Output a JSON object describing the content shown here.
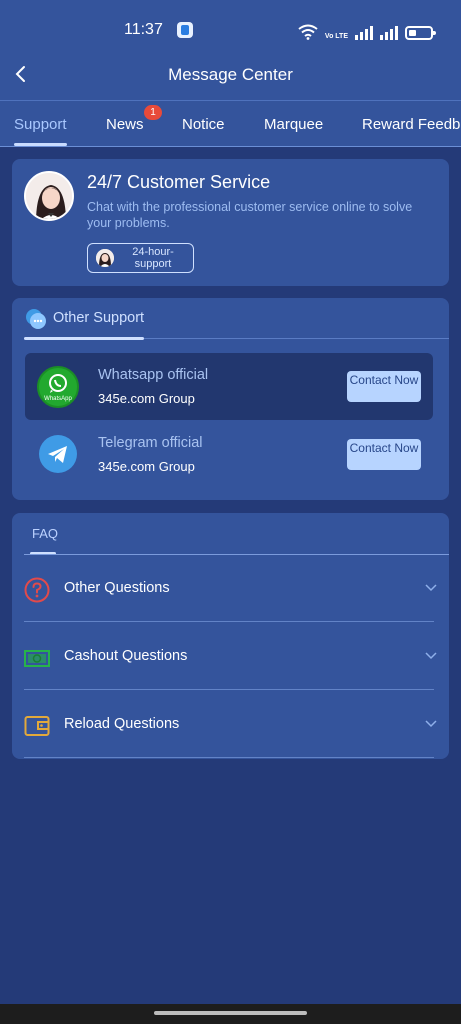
{
  "status_bar": {
    "time": "11:37",
    "network_label": "Vo LTE",
    "icons": [
      "app-notification-icon",
      "wifi-icon",
      "signal-icon",
      "battery-icon"
    ]
  },
  "header": {
    "title": "Message Center",
    "back_icon": "chevron-left-icon"
  },
  "tabs": [
    {
      "label": "Support",
      "active": true
    },
    {
      "label": "News",
      "badge": "1"
    },
    {
      "label": "Notice"
    },
    {
      "label": "Marquee"
    },
    {
      "label": "Reward Feedb"
    }
  ],
  "customer_service": {
    "title": "24/7 Customer Service",
    "description": "Chat with the professional customer service online to solve your problems.",
    "chip_label": "24-hour-support"
  },
  "other_support": {
    "title": "Other Support",
    "items": [
      {
        "name": "Whatsapp official",
        "group": "345e.com Group",
        "button": "Contact Now",
        "icon": "whatsapp-icon",
        "icon_text": "WhatsApp"
      },
      {
        "name": "Telegram official",
        "group": "345e.com Group",
        "button": "Contact Now",
        "icon": "telegram-icon"
      }
    ]
  },
  "faq": {
    "tab_label": "FAQ",
    "items": [
      {
        "label": "Other Questions",
        "icon": "question-icon",
        "color": "#e24a4a"
      },
      {
        "label": "Cashout Questions",
        "icon": "cash-icon",
        "color": "#27b34a"
      },
      {
        "label": "Reload Questions",
        "icon": "wallet-icon",
        "color": "#e2a93b"
      }
    ]
  },
  "colors": {
    "background": "#243a78",
    "card": "#34549c",
    "accent": "#b7d4ff",
    "badge": "#e84a3a"
  }
}
